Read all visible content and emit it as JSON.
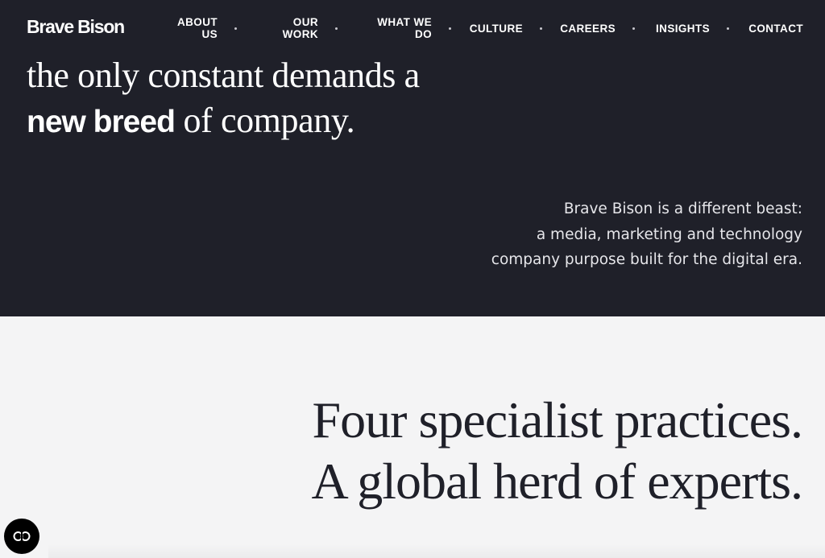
{
  "brand": {
    "name": "Brave Bison"
  },
  "nav": {
    "items": [
      {
        "label": "ABOUT\nUS"
      },
      {
        "label": "OUR\nWORK"
      },
      {
        "label": "WHAT WE\nDO"
      },
      {
        "label": "CULTURE"
      },
      {
        "label": "CAREERS"
      },
      {
        "label": "INSIGHTS"
      },
      {
        "label": "CONTACT"
      }
    ]
  },
  "hero": {
    "headline_line1": "the only constant demands a",
    "headline_bold": "new breed",
    "headline_rest": " of company.",
    "blurb_line1": "Brave Bison is a different beast:",
    "blurb_line2": "a media, marketing and technology",
    "blurb_line3": "company purpose built for the digital era."
  },
  "practices": {
    "line1": "Four specialist practices.",
    "line2": "A global herd of experts."
  },
  "widget": {
    "icon": "accessibility-toggle-icon"
  },
  "colors": {
    "dark_bg": "#1f2029",
    "light_bg": "#f4f4f5",
    "text_dark": "#1f2029"
  }
}
